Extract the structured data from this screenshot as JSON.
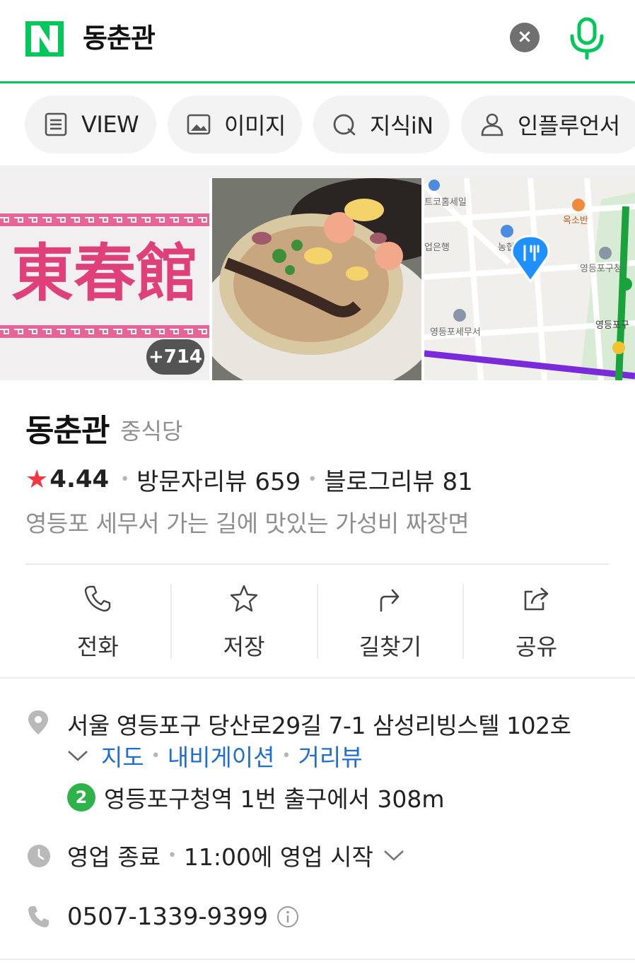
{
  "header": {
    "logo_text": "N",
    "query": "동춘관",
    "clear_label": "×",
    "brand_color": "#03c75a"
  },
  "tabs": [
    {
      "label": "VIEW",
      "icon": "document-icon"
    },
    {
      "label": "이미지",
      "icon": "image-icon"
    },
    {
      "label": "지식iN",
      "icon": "q-bubble-icon"
    },
    {
      "label": "인플루언서",
      "icon": "person-icon"
    }
  ],
  "photos": {
    "sign_text": "東春館",
    "more_count": "+714",
    "map_labels": [
      "트코홈세일",
      "옥소반",
      "업은행",
      "농협",
      "영등포구청",
      "영등포세무서",
      "영등포구"
    ]
  },
  "place": {
    "name": "동춘관",
    "category": "중식당",
    "rating": "4.44",
    "visitor_reviews": "방문자리뷰 659",
    "blog_reviews": "블로그리뷰 81",
    "description": "영등포 세무서 가는 길에 맛있는 가성비 짜장면"
  },
  "actions": [
    {
      "label": "전화",
      "icon": "phone-icon"
    },
    {
      "label": "저장",
      "icon": "star-icon"
    },
    {
      "label": "길찾기",
      "icon": "directions-icon"
    },
    {
      "label": "공유",
      "icon": "share-icon"
    }
  ],
  "details": {
    "address": "서울 영등포구 당산로29길 7-1 삼성리빙스텔 102호",
    "links": [
      "지도",
      "내비게이션",
      "거리뷰"
    ],
    "subway_line": "2",
    "subway_text": "영등포구청역 1번 출구에서 308m",
    "status": "영업 종료",
    "hours": "11:00에 영업 시작",
    "phone": "0507-1339-9399"
  },
  "colors": {
    "accent_green": "#03c75a",
    "star_red": "#f5363f",
    "link_blue": "#1e6fcf",
    "line2_green": "#2db34a"
  }
}
